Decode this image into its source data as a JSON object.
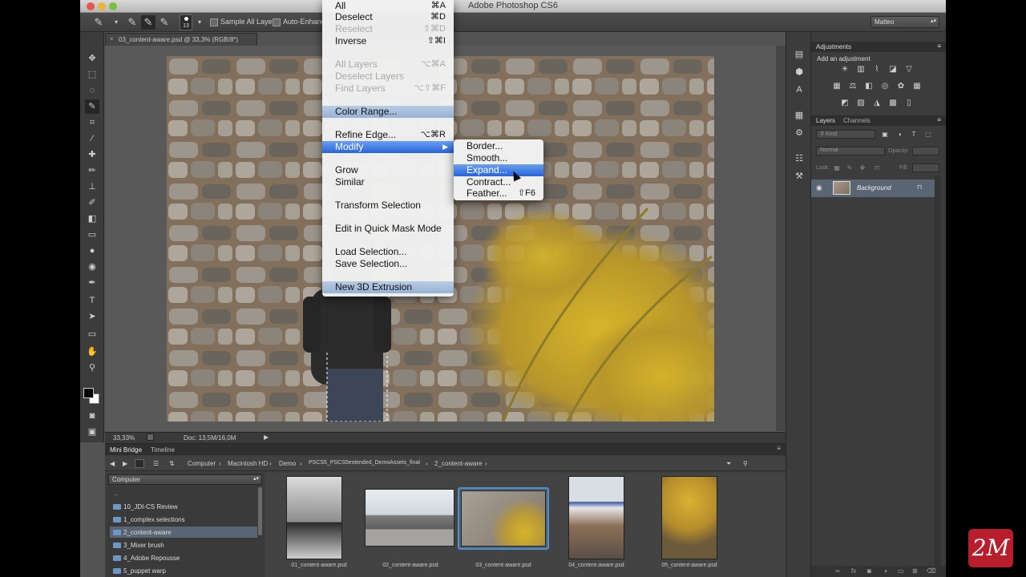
{
  "app": {
    "title": "Adobe Photoshop CS6",
    "workspace": "Matteo"
  },
  "options_bar": {
    "brush_size": "13",
    "sample_all_layers": "Sample All Layers",
    "auto_enhance": "Auto-Enhance"
  },
  "document": {
    "tab_label": "03_content-aware.psd @ 33,3% (RGB/8*)",
    "zoom": "33,33%",
    "doc_size": "Doc: 13,5M/16,0M"
  },
  "select_menu": {
    "items": [
      {
        "label": "All",
        "shortcut": "⌘A",
        "state": "normal"
      },
      {
        "label": "Deselect",
        "shortcut": "⌘D",
        "state": "normal"
      },
      {
        "label": "Reselect",
        "shortcut": "⇧⌘D",
        "state": "disabled"
      },
      {
        "label": "Inverse",
        "shortcut": "⇧⌘I",
        "state": "normal"
      },
      {
        "label": "All Layers",
        "shortcut": "⌥⌘A",
        "state": "disabled"
      },
      {
        "label": "Deselect Layers",
        "shortcut": "",
        "state": "disabled"
      },
      {
        "label": "Find Layers",
        "shortcut": "⌥⇧⌘F",
        "state": "disabled"
      },
      {
        "label": "Color Range...",
        "shortcut": "",
        "state": "light"
      },
      {
        "label": "Refine Edge...",
        "shortcut": "⌥⌘R",
        "state": "normal"
      },
      {
        "label": "Modify",
        "shortcut": "",
        "state": "highlight"
      },
      {
        "label": "Grow",
        "shortcut": "",
        "state": "normal"
      },
      {
        "label": "Similar",
        "shortcut": "",
        "state": "normal"
      },
      {
        "label": "Transform Selection",
        "shortcut": "",
        "state": "normal"
      },
      {
        "label": "Edit in Quick Mask Mode",
        "shortcut": "",
        "state": "normal"
      },
      {
        "label": "Load Selection...",
        "shortcut": "",
        "state": "normal"
      },
      {
        "label": "Save Selection...",
        "shortcut": "",
        "state": "normal"
      },
      {
        "label": "New 3D Extrusion",
        "shortcut": "",
        "state": "light"
      }
    ]
  },
  "modify_submenu": {
    "items": [
      {
        "label": "Border...",
        "shortcut": "",
        "state": "normal"
      },
      {
        "label": "Smooth...",
        "shortcut": "",
        "state": "normal"
      },
      {
        "label": "Expand...",
        "shortcut": "",
        "state": "highlight"
      },
      {
        "label": "Contract...",
        "shortcut": "",
        "state": "normal"
      },
      {
        "label": "Feather...",
        "shortcut": "⇧F6",
        "state": "normal"
      }
    ]
  },
  "mini_bridge": {
    "tabs": [
      "Mini Bridge",
      "Timeline"
    ],
    "breadcrumb": [
      "Computer",
      "Macintosh HD",
      "Demo",
      "PSCS5_PSCS5extended_DemoAssets_final",
      "2_content-aware"
    ],
    "location": "Computer",
    "folders": [
      "..",
      "10_JDI-CS Review",
      "1_complex selections",
      "2_content-aware",
      "3_Mixer brush",
      "4_Adobe Repousse",
      "5_puppet warp"
    ],
    "files": [
      "01_content-aware.psd",
      "02_content-aware.psd",
      "03_content-aware.psd",
      "04_content-aware.psd",
      "05_content-aware.psd"
    ]
  },
  "panels": {
    "adjustments_title": "Adjustments",
    "add_adjustment": "Add an adjustment",
    "layers_tabs": [
      "Layers",
      "Channels"
    ],
    "kind_filter": "Kind",
    "blend_mode": "Normal",
    "opacity_label": "Opacity:",
    "lock_label": "Lock:",
    "fill_label": "Fill:",
    "layer_name": "Background"
  },
  "brand": {
    "badge_text": "2M",
    "badge_color": "#b71d2b"
  },
  "colors": {
    "menu_highlight": "#2864dc",
    "selection_blue": "#4d8fcf"
  }
}
